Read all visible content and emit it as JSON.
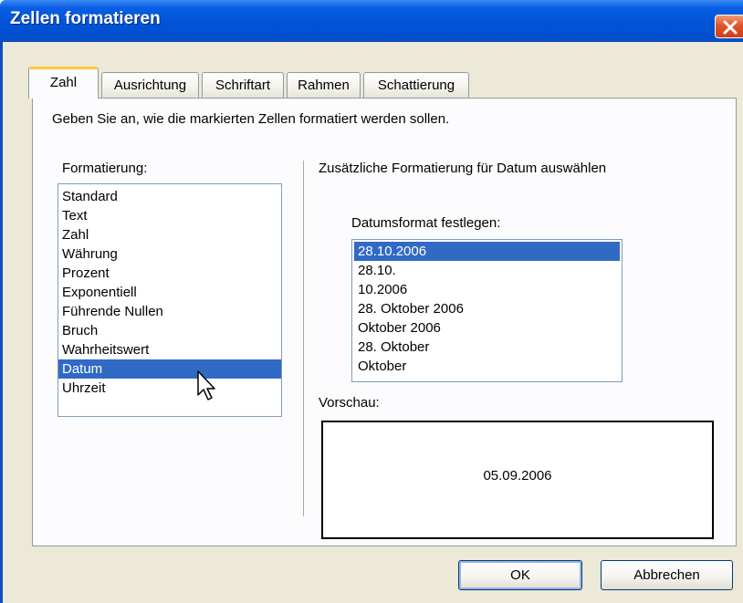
{
  "window": {
    "title": "Zellen formatieren"
  },
  "tabs": [
    {
      "label": "Zahl",
      "active": true
    },
    {
      "label": "Ausrichtung",
      "active": false
    },
    {
      "label": "Schriftart",
      "active": false
    },
    {
      "label": "Rahmen",
      "active": false
    },
    {
      "label": "Schattierung",
      "active": false
    }
  ],
  "panel": {
    "description": "Geben Sie an, wie die markierten Zellen formatiert werden sollen.",
    "format_label": "Formatierung:",
    "format_items": [
      "Standard",
      "Text",
      "Zahl",
      "Währung",
      "Prozent",
      "Exponentiell",
      "Führende Nullen",
      "Bruch",
      "Wahrheitswert",
      "Datum",
      "Uhrzeit"
    ],
    "format_selected": "Datum",
    "extra_heading": "Zusätzliche Formatierung für Datum auswählen",
    "date_label": "Datumsformat festlegen:",
    "date_items": [
      "28.10.2006",
      "28.10.",
      "10.2006",
      "28. Oktober 2006",
      "Oktober 2006",
      "28. Oktober",
      "Oktober"
    ],
    "date_selected": "28.10.2006",
    "preview_label": "Vorschau:",
    "preview_value": "05.09.2006"
  },
  "buttons": {
    "ok": "OK",
    "cancel": "Abbrechen"
  },
  "colors": {
    "titlebar": "#0254d8",
    "selection": "#316ac5",
    "dialog_bg": "#ece9d8",
    "active_tab_accent": "#ffc83c",
    "close_button": "#e2552a"
  },
  "icons": {
    "close": "close-icon",
    "cursor": "mouse-pointer-icon"
  }
}
